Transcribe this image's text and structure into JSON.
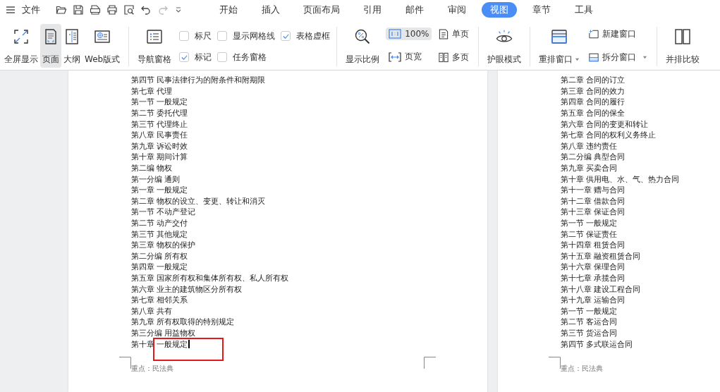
{
  "menu": {
    "label": "文件"
  },
  "tabs": [
    {
      "label": "开始",
      "selected": false
    },
    {
      "label": "插入",
      "selected": false
    },
    {
      "label": "页面布局",
      "selected": false
    },
    {
      "label": "引用",
      "selected": false
    },
    {
      "label": "邮件",
      "selected": false
    },
    {
      "label": "审阅",
      "selected": false
    },
    {
      "label": "视图",
      "selected": true
    },
    {
      "label": "章节",
      "selected": false
    },
    {
      "label": "工具",
      "selected": false
    }
  ],
  "view_buttons": [
    {
      "label": "全屏显示",
      "kind": "fullscreen",
      "selected": false
    },
    {
      "label": "页面",
      "kind": "page",
      "selected": true
    },
    {
      "label": "大纲",
      "kind": "outline",
      "selected": false
    },
    {
      "label": "Web版式",
      "kind": "web",
      "selected": false
    }
  ],
  "nav_pane": {
    "label": "导航窗格"
  },
  "checkboxes": [
    {
      "label": "标尺",
      "checked": false
    },
    {
      "label": "标记",
      "checked": true
    },
    {
      "label": "显示网格线",
      "checked": false
    },
    {
      "label": "任务窗格",
      "checked": false
    },
    {
      "label": "表格虚框",
      "checked": true
    }
  ],
  "zoom": {
    "label": "显示比例"
  },
  "zoom_buttons": [
    {
      "label": "100%",
      "kind": "ratio",
      "selected": true
    },
    {
      "label": "页宽",
      "kind": "width",
      "selected": false
    }
  ],
  "page_modes": [
    {
      "label": "单页",
      "kind": "single"
    },
    {
      "label": "多页",
      "kind": "multi"
    }
  ],
  "eye_mode": {
    "label": "护眼模式"
  },
  "window_buttons": [
    {
      "label": "重排窗口",
      "kind": "arrange",
      "dropdown": true
    },
    {
      "label": "新建窗口",
      "kind": "new",
      "dropdown": false
    },
    {
      "label": "拆分窗口",
      "kind": "split",
      "dropdown": true
    }
  ],
  "compare": {
    "label": "并排比较"
  },
  "pages": [
    {
      "lines": [
        {
          "text": "第四节 民事法律行为的附条件和附期限",
          "cursor": false,
          "marked": false
        },
        {
          "text": "第七章 代理",
          "cursor": false,
          "marked": false
        },
        {
          "text": "第一节 一般规定",
          "cursor": false,
          "marked": false
        },
        {
          "text": "第二节 委托代理",
          "cursor": false,
          "marked": false
        },
        {
          "text": "第三节 代理终止",
          "cursor": false,
          "marked": false
        },
        {
          "text": "第八章 民事责任",
          "cursor": false,
          "marked": false
        },
        {
          "text": "第九章 诉讼时效",
          "cursor": false,
          "marked": false
        },
        {
          "text": "第十章 期间计算",
          "cursor": false,
          "marked": false
        },
        {
          "text": "第二编 物权",
          "cursor": false,
          "marked": false
        },
        {
          "text": "第一分编 通则",
          "cursor": false,
          "marked": false
        },
        {
          "text": "第一章 一般规定",
          "cursor": false,
          "marked": false
        },
        {
          "text": "第二章 物权的设立、变更、转让和消灭",
          "cursor": false,
          "marked": false
        },
        {
          "text": "第一节 不动产登记",
          "cursor": false,
          "marked": false
        },
        {
          "text": "第二节 动产交付",
          "cursor": false,
          "marked": false
        },
        {
          "text": "第三节 其他规定",
          "cursor": false,
          "marked": false
        },
        {
          "text": "第三章 物权的保护",
          "cursor": false,
          "marked": false
        },
        {
          "text": "第二分编 所有权",
          "cursor": false,
          "marked": false
        },
        {
          "text": "第四章 一般规定",
          "cursor": false,
          "marked": false
        },
        {
          "text": "第五章 国家所有权和集体所有权、私人所有权",
          "cursor": false,
          "marked": false
        },
        {
          "text": "第六章 业主的建筑物区分所有权",
          "cursor": false,
          "marked": false
        },
        {
          "text": "第七章 相邻关系",
          "cursor": false,
          "marked": false
        },
        {
          "text": "第八章 共有",
          "cursor": false,
          "marked": false
        },
        {
          "text": "第九章 所有权取得的特别规定",
          "cursor": false,
          "marked": false
        },
        {
          "text": "第三分编 用益物权",
          "cursor": false,
          "marked": false
        },
        {
          "text": "第十章 一般规定",
          "cursor": true,
          "marked": true
        }
      ],
      "footer": "重点：民法典"
    },
    {
      "lines": [
        {
          "text": "第二章 合同的订立",
          "cursor": false,
          "marked": false
        },
        {
          "text": "第三章 合同的效力",
          "cursor": false,
          "marked": false
        },
        {
          "text": "第四章 合同的履行",
          "cursor": false,
          "marked": false
        },
        {
          "text": "第五章 合同的保全",
          "cursor": false,
          "marked": false
        },
        {
          "text": "第六章 合同的变更和转让",
          "cursor": false,
          "marked": false
        },
        {
          "text": "第七章 合同的权利义务终止",
          "cursor": false,
          "marked": false
        },
        {
          "text": "第八章 违约责任",
          "cursor": false,
          "marked": false
        },
        {
          "text": "第二分编 典型合同",
          "cursor": false,
          "marked": false
        },
        {
          "text": "第九章 买卖合同",
          "cursor": false,
          "marked": false
        },
        {
          "text": "第十章 供用电、水、气、热力合同",
          "cursor": false,
          "marked": false
        },
        {
          "text": "第十一章 赠与合同",
          "cursor": false,
          "marked": false
        },
        {
          "text": "第十二章 借款合同",
          "cursor": false,
          "marked": false
        },
        {
          "text": "第十三章 保证合同",
          "cursor": false,
          "marked": false
        },
        {
          "text": "第一节 一般规定",
          "cursor": false,
          "marked": false
        },
        {
          "text": "第二节 保证责任",
          "cursor": false,
          "marked": false
        },
        {
          "text": "第十四章 租赁合同",
          "cursor": false,
          "marked": false
        },
        {
          "text": "第十五章 融资租赁合同",
          "cursor": false,
          "marked": false
        },
        {
          "text": "第十六章 保理合同",
          "cursor": false,
          "marked": false
        },
        {
          "text": "第十七章 承揽合同",
          "cursor": false,
          "marked": false
        },
        {
          "text": "第十八章 建设工程合同",
          "cursor": false,
          "marked": false
        },
        {
          "text": "第十九章 运输合同",
          "cursor": false,
          "marked": false
        },
        {
          "text": "第一节 一般规定",
          "cursor": false,
          "marked": false
        },
        {
          "text": "第二节 客运合同",
          "cursor": false,
          "marked": false
        },
        {
          "text": "第三节 货运合同",
          "cursor": false,
          "marked": false
        },
        {
          "text": "第四节 多式联运合同",
          "cursor": false,
          "marked": false
        }
      ],
      "footer": "重点：民法典"
    }
  ]
}
